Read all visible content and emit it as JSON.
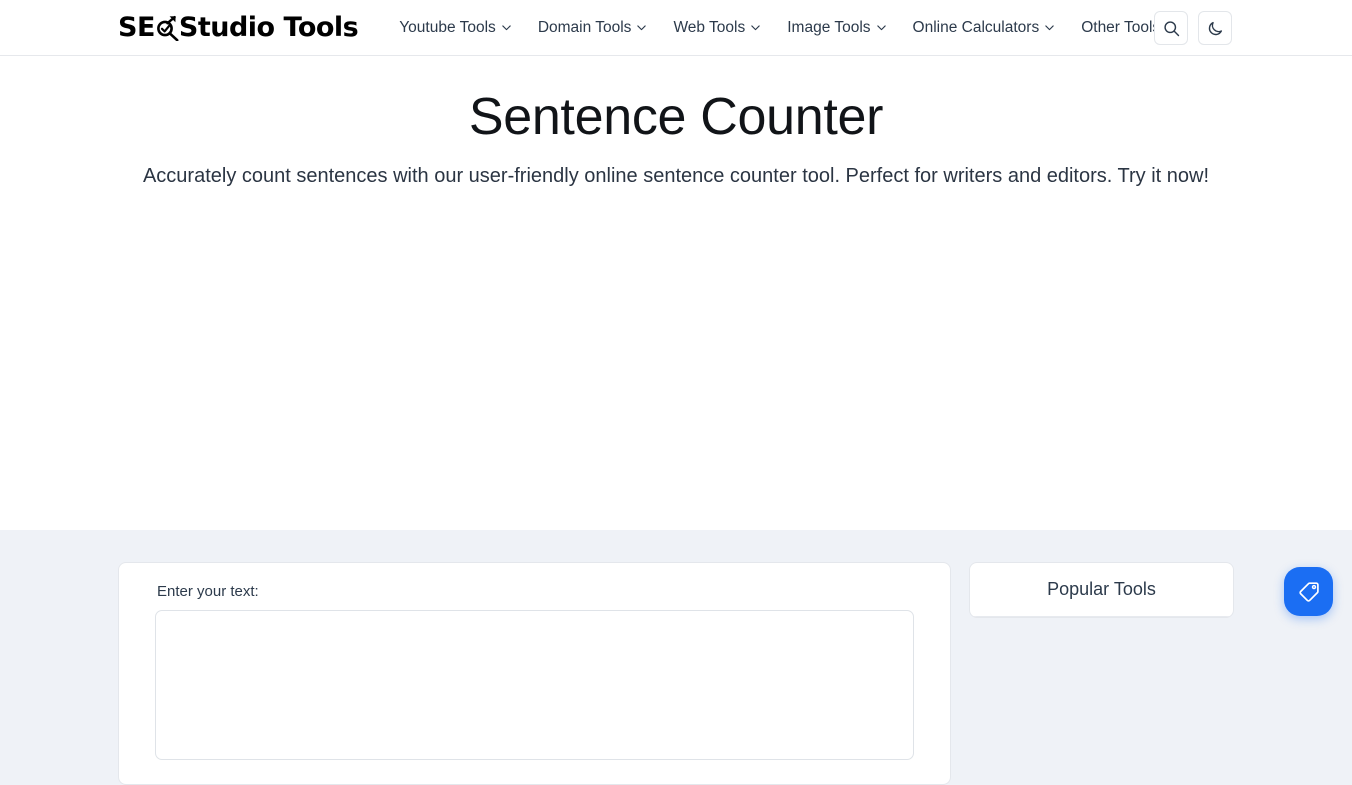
{
  "header": {
    "brand": {
      "text_before": "SE",
      "text_after": "Studio Tools",
      "glyph_icon": "magnifier-arrow-icon",
      "full_name": "SEO Studio Tools"
    },
    "nav": [
      {
        "label": "Youtube Tools",
        "has_dropdown": true,
        "icon": "chevron-down-icon"
      },
      {
        "label": "Domain Tools",
        "has_dropdown": true,
        "icon": "chevron-down-icon"
      },
      {
        "label": "Web Tools",
        "has_dropdown": true,
        "icon": "chevron-down-icon"
      },
      {
        "label": "Image Tools",
        "has_dropdown": true,
        "icon": "chevron-down-icon"
      },
      {
        "label": "Online Calculators",
        "has_dropdown": true,
        "icon": "chevron-down-icon"
      },
      {
        "label": "Other Tools",
        "has_dropdown": true,
        "icon": "chevron-down-icon"
      }
    ],
    "actions": [
      {
        "name": "search-button",
        "icon": "search-icon",
        "title": "Search"
      },
      {
        "name": "dark-mode-toggle",
        "icon": "moon-icon",
        "title": "Dark mode"
      }
    ]
  },
  "hero": {
    "title": "Sentence Counter",
    "subtitle": "Accurately count sentences with our user-friendly online sentence counter tool. Perfect for writers and editors. Try it now!"
  },
  "tool": {
    "text_label": "Enter your text:",
    "text_value": "",
    "text_placeholder": ""
  },
  "sidebar": {
    "title": "Popular Tools",
    "items": []
  },
  "fab": {
    "icon": "tag-icon",
    "title": "Offers"
  },
  "colors": {
    "accent": "#1b6ef3",
    "page_background": "#ffffff",
    "section_background": "#eff2f7",
    "text": "#2c3a4b",
    "border": "#e4e7ec"
  }
}
